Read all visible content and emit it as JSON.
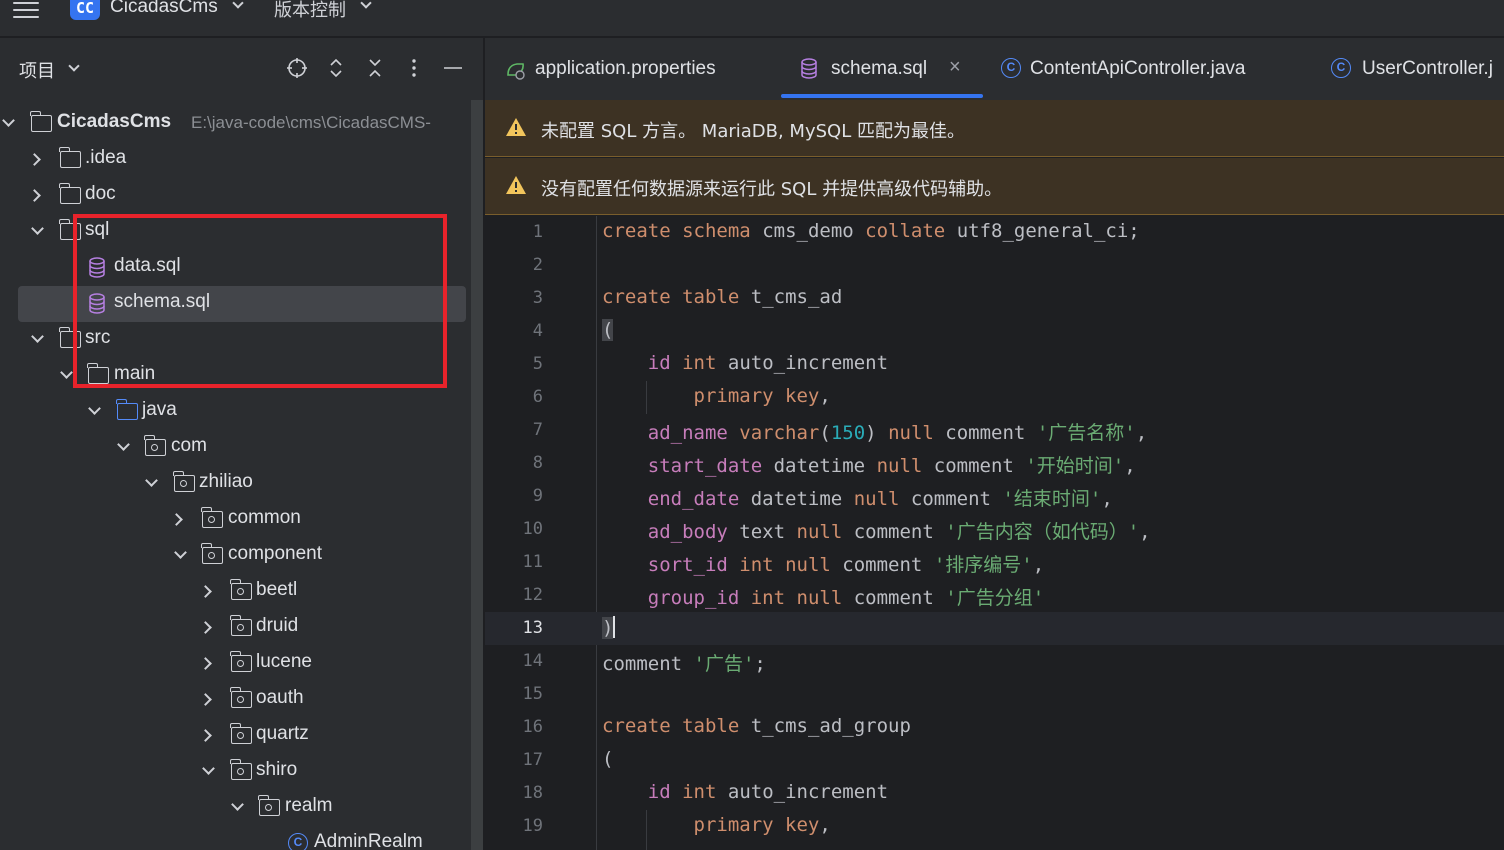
{
  "topbar": {
    "project_badge": "CC",
    "project_name": "CicadasCms",
    "vcs_label": "版本控制"
  },
  "panel": {
    "title": "项目",
    "tree": [
      {
        "label": "CicadasCms",
        "path": "E:\\java-code\\cms\\CicadasCMS-",
        "expanded": true,
        "icon": "module-folder-icon"
      },
      {
        "label": ".idea",
        "expanded": false,
        "icon": "folder-icon"
      },
      {
        "label": "doc",
        "expanded": false,
        "icon": "folder-icon"
      },
      {
        "label": "sql",
        "expanded": true,
        "icon": "folder-icon"
      },
      {
        "label": "data.sql",
        "icon": "database-icon"
      },
      {
        "label": "schema.sql",
        "icon": "database-icon",
        "selected": true
      },
      {
        "label": "src",
        "expanded": true,
        "icon": "folder-icon"
      },
      {
        "label": "main",
        "expanded": true,
        "icon": "folder-icon"
      },
      {
        "label": "java",
        "expanded": true,
        "icon": "source-folder-icon"
      },
      {
        "label": "com",
        "expanded": true,
        "icon": "package-icon"
      },
      {
        "label": "zhiliao",
        "expanded": true,
        "icon": "package-icon"
      },
      {
        "label": "common",
        "expanded": false,
        "icon": "package-icon"
      },
      {
        "label": "component",
        "expanded": true,
        "icon": "package-icon"
      },
      {
        "label": "beetl",
        "expanded": false,
        "icon": "package-icon"
      },
      {
        "label": "druid",
        "expanded": false,
        "icon": "package-icon"
      },
      {
        "label": "lucene",
        "expanded": false,
        "icon": "package-icon"
      },
      {
        "label": "oauth",
        "expanded": false,
        "icon": "package-icon"
      },
      {
        "label": "quartz",
        "expanded": false,
        "icon": "package-icon"
      },
      {
        "label": "shiro",
        "expanded": true,
        "icon": "package-icon"
      },
      {
        "label": "realm",
        "expanded": true,
        "icon": "package-icon"
      },
      {
        "label": "AdminRealm",
        "icon": "class-icon"
      }
    ]
  },
  "tabs": [
    {
      "label": "application.properties",
      "icon": "properties-icon"
    },
    {
      "label": "schema.sql",
      "icon": "database-icon",
      "active": true
    },
    {
      "label": "ContentApiController.java",
      "icon": "class-icon"
    },
    {
      "label": "UserController.j",
      "icon": "class-icon"
    }
  ],
  "warnings": [
    "未配置 SQL 方言。 MariaDB, MySQL 匹配为最佳。",
    "没有配置任何数据源来运行此 SQL 并提供高级代码辅助。"
  ],
  "editor": {
    "current_line": 13,
    "line_numbers": [
      "1",
      "2",
      "3",
      "4",
      "5",
      "6",
      "7",
      "8",
      "9",
      "10",
      "11",
      "12",
      "13",
      "14",
      "15",
      "16",
      "17",
      "18",
      "19"
    ],
    "tokens": {
      "l1": [
        "create",
        "schema",
        "cms_demo",
        "collate",
        "utf8_general_ci;"
      ],
      "l3": [
        "create",
        "table",
        "t_cms_ad"
      ],
      "l4": [
        "("
      ],
      "l5": [
        "id",
        "int",
        "auto_increment"
      ],
      "l6": [
        "primary key",
        ","
      ],
      "l7": [
        "ad_name",
        "varchar",
        "(",
        "150",
        ")",
        "null",
        "comment",
        "'广告名称'",
        ","
      ],
      "l8": [
        "start_date",
        "datetime",
        "null",
        "comment",
        "'开始时间'",
        ","
      ],
      "l9": [
        "end_date",
        "datetime",
        "null",
        "comment",
        "'结束时间'",
        ","
      ],
      "l10": [
        "ad_body",
        "text",
        "null",
        "comment",
        "'广告内容（如代码）'",
        ","
      ],
      "l11": [
        "sort_id",
        "int",
        "null",
        "comment",
        "'排序编号'",
        ","
      ],
      "l12": [
        "group_id",
        "int",
        "null",
        "comment",
        "'广告分组'"
      ],
      "l13": [
        ")"
      ],
      "l14": [
        "comment",
        "'广告'",
        ";"
      ],
      "l16": [
        "create",
        "table",
        "t_cms_ad_group"
      ],
      "l17": [
        "("
      ],
      "l18": [
        "id",
        "int",
        "auto_increment"
      ],
      "l19": [
        "primary key",
        ","
      ]
    }
  },
  "colors": {
    "accent": "#3574f0",
    "keyword": "#cf8e6d",
    "field": "#c77dbb",
    "number": "#2aacb8",
    "string": "#6aab73",
    "highlight_box": "#e8232b",
    "warning_bg": "#3d3223"
  }
}
